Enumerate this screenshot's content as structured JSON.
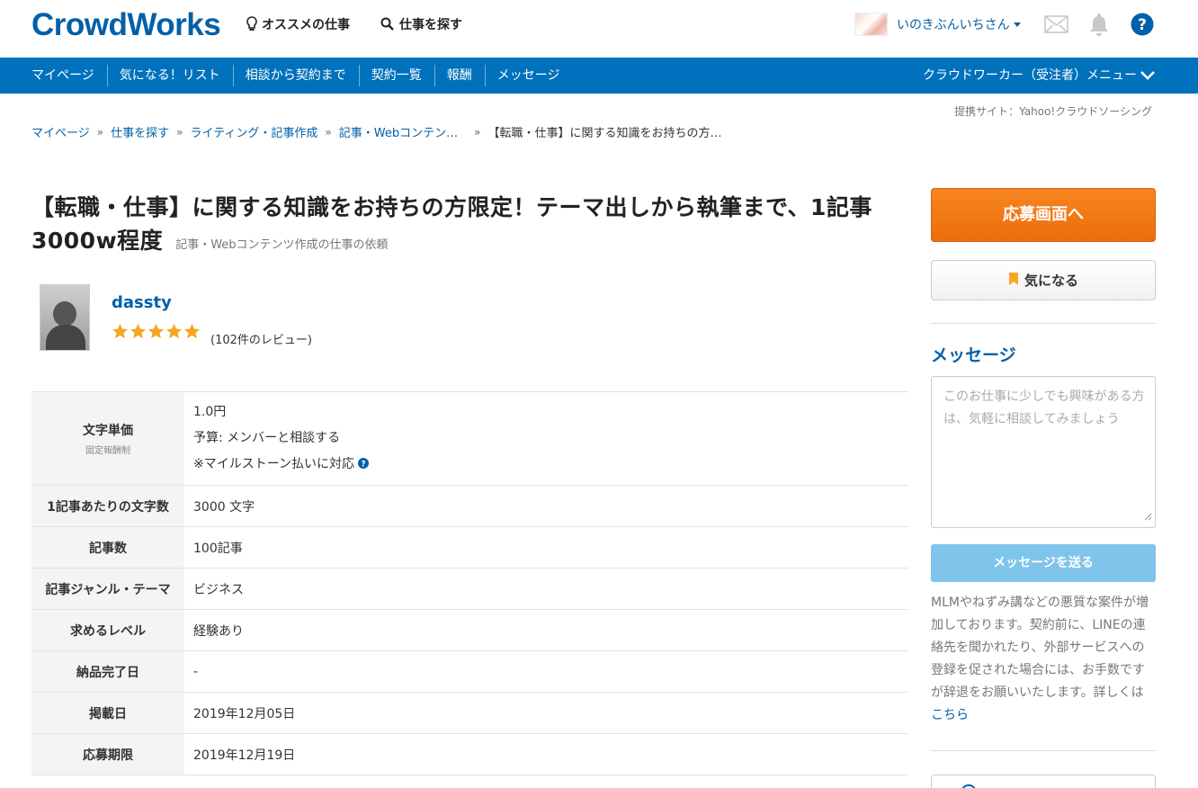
{
  "header": {
    "logo": "CrowdWorks",
    "recommend": "オススメの仕事",
    "search": "仕事を探す",
    "username": "いのきぶんいちさん"
  },
  "nav": {
    "items": [
      "マイページ",
      "気になる！リスト",
      "相談から契約まで",
      "契約一覧",
      "報酬",
      "メッセージ"
    ],
    "menu": "クラウドワーカー（受注者）メニュー"
  },
  "partner_site": "提携サイト：Yahoo!クラウドソーシング",
  "breadcrumb": [
    "マイページ",
    "仕事を探す",
    "ライティング・記事作成",
    "記事・Webコンテン…",
    "【転職・仕事】に関する知識をお持ちの方…"
  ],
  "job": {
    "title": "【転職・仕事】に関する知識をお持ちの方限定！テーマ出しから執筆まで、1記事3000w程度",
    "category": "記事・Webコンテンツ作成の仕事の依頼"
  },
  "client": {
    "name": "dassty",
    "rating_stars": 5,
    "reviews": "(102件のレビュー)"
  },
  "details": {
    "price_label": "文字単価",
    "price_sub": "固定報酬制",
    "price_value": "1.0円",
    "budget": "予算: メンバーと相談する",
    "milestone": "※マイルストーン払いに対応",
    "rows": [
      {
        "label": "1記事あたりの文字数",
        "value": "3000 文字"
      },
      {
        "label": "記事数",
        "value": "100記事"
      },
      {
        "label": "記事ジャンル・テーマ",
        "value": "ビジネス"
      },
      {
        "label": "求めるレベル",
        "value": "経験あり"
      },
      {
        "label": "納品完了日",
        "value": "-"
      },
      {
        "label": "掲載日",
        "value": "2019年12月05日"
      },
      {
        "label": "応募期限",
        "value": "2019年12月19日"
      }
    ]
  },
  "sidebar": {
    "apply": "応募画面へ",
    "favorite": "気になる",
    "message_heading": "メッセージ",
    "message_placeholder": "このお仕事に少しでも興味がある方は、気軽に相談してみましょう",
    "send": "メッセージを送る",
    "warning": "MLMやねずみ講などの悪質な案件が増加しております。契約前に、LINEの連絡先を聞かれたり、外部サービスへの登録を促された場合には、お手数ですが辞退をお願いいたします。詳しくは",
    "warning_link": "こちら"
  },
  "colors": {
    "brand": "#0060a9",
    "nav": "#0071bc",
    "apply": "#ef730f",
    "send": "#7fc4ea",
    "star": "#f5a623"
  }
}
